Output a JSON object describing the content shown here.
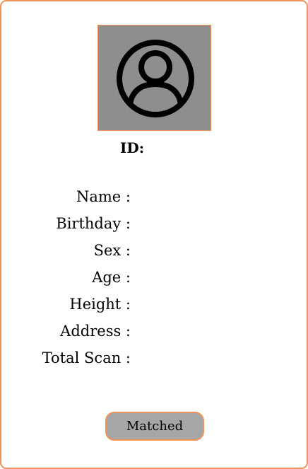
{
  "profile": {
    "avatar_icon": "user-circle-icon",
    "id_label": "ID:"
  },
  "fields": [
    {
      "label": "Name :"
    },
    {
      "label": "Birthday :"
    },
    {
      "label": "Sex :"
    },
    {
      "label": "Age :"
    },
    {
      "label": "Height :"
    },
    {
      "label": "Address :"
    },
    {
      "label": "Total Scan :"
    }
  ],
  "actions": {
    "matched_label": "Matched"
  },
  "colors": {
    "border_accent": "#f0945c",
    "avatar_background": "#8e8e8e",
    "button_background": "#a6a6a6"
  }
}
